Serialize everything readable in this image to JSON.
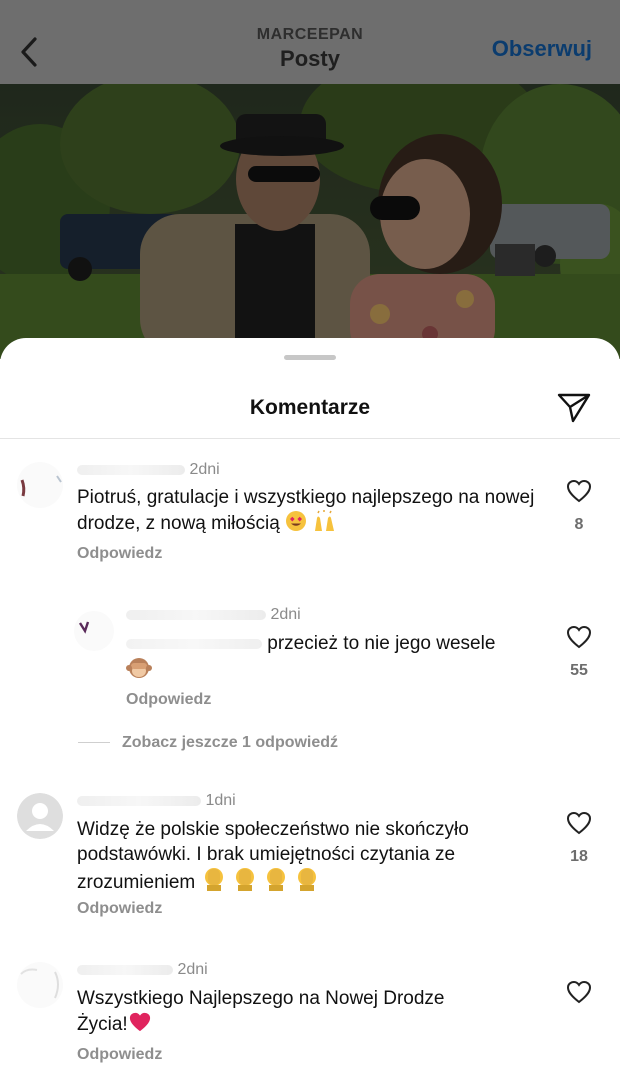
{
  "header": {
    "username": "MARCEEPAN",
    "title": "Posty",
    "follow_label": "Obserwuj"
  },
  "icons": {
    "back": "chevron-left-icon",
    "share": "send-icon",
    "like": "heart-outline-icon"
  },
  "colors": {
    "follow": "#0b3c6e",
    "heart_red": "#e0245e"
  },
  "sheet": {
    "title": "Komentarze"
  },
  "comments": [
    {
      "time": "2dni",
      "text": "Piotruś,  gratulacje i wszystkiego najlepszego na nowej drodze, z nową miłością",
      "emojis": [
        "heart-eyes-emoji",
        "raised-hands-emoji"
      ],
      "reply_label": "Odpowiedz",
      "likes": "8"
    },
    {
      "time": "2dni",
      "text": "przecież to nie jego wesele",
      "emojis": [
        "see-no-evil-monkey-emoji"
      ],
      "reply_label": "Odpowiedz",
      "likes": "55",
      "more_replies": "Zobacz jeszcze 1 odpowiedź"
    },
    {
      "time": "1dni",
      "text_line1": "Widzę że polskie społeczeństwo nie skończyło",
      "text_line2": "podstawówki. I brak umiejętności czytania ze",
      "text_line3": "zrozumieniem",
      "emojis": [
        "facepalm-emoji",
        "facepalm-emoji",
        "facepalm-emoji",
        "facepalm-emoji"
      ],
      "reply_label": "Odpowiedz",
      "likes": "18"
    },
    {
      "time": "2dni",
      "text_line1": "Wszystkiego Najlepszego na Nowej Drodze",
      "text_line2": "Życia!",
      "emojis": [
        "red-heart-emoji"
      ],
      "reply_label": "Odpowiedz"
    }
  ]
}
